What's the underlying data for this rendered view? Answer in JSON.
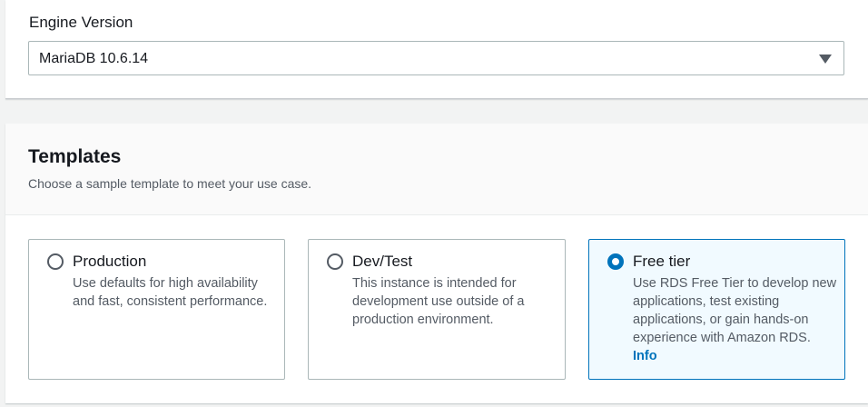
{
  "engine": {
    "label": "Engine Version",
    "selected_value": "MariaDB 10.6.14"
  },
  "templates": {
    "title": "Templates",
    "description": "Choose a sample template to meet your use case.",
    "options": [
      {
        "title": "Production",
        "description": "Use defaults for high availability and fast, consistent performance.",
        "selected": false
      },
      {
        "title": "Dev/Test",
        "description": "This instance is intended for development use outside of a production environment.",
        "selected": false
      },
      {
        "title": "Free tier",
        "description": "Use RDS Free Tier to develop new applications, test existing applications, or gain hands-on experience with Amazon RDS.",
        "link": "Info",
        "selected": true
      }
    ]
  },
  "colors": {
    "accent": "#0073bb",
    "selected_tile_bg": "#f1faff",
    "border": "#aab7b8"
  }
}
